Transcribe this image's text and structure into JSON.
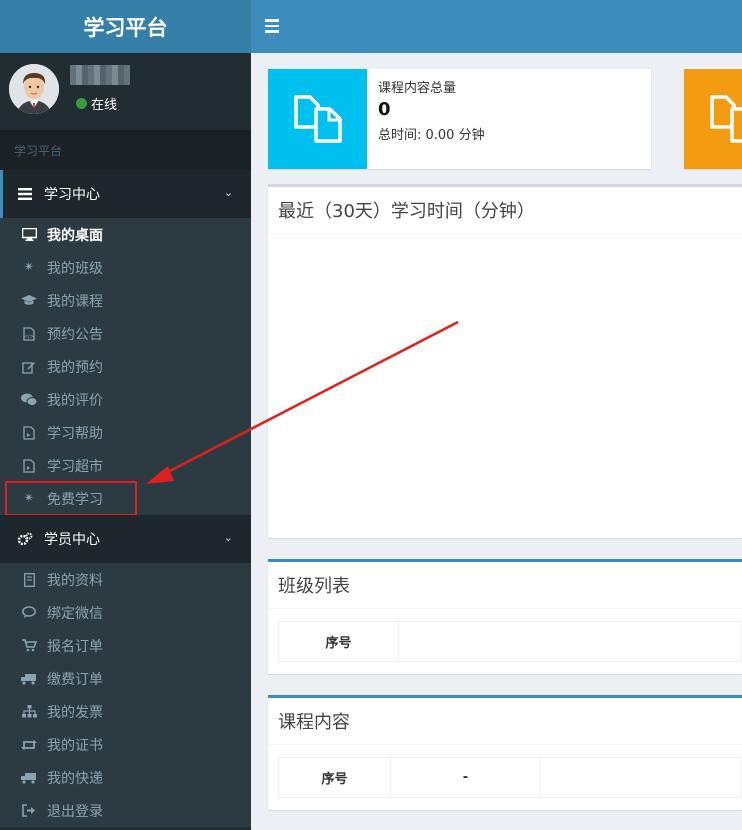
{
  "header": {
    "app_title": "学习平台"
  },
  "user": {
    "status": "在线"
  },
  "sidebar": {
    "section_label": "学习平台",
    "groups": [
      {
        "label": "学习中心",
        "items": [
          {
            "label": "我的桌面",
            "icon": "desktop-icon"
          },
          {
            "label": "我的班级",
            "icon": "asterisk-icon"
          },
          {
            "label": "我的课程",
            "icon": "graduation-cap-icon"
          },
          {
            "label": "预约公告",
            "icon": "file-code-icon"
          },
          {
            "label": "我的预约",
            "icon": "edit-icon"
          },
          {
            "label": "我的评价",
            "icon": "wechat-icon"
          },
          {
            "label": "学习帮助",
            "icon": "file-video-icon"
          },
          {
            "label": "学习超市",
            "icon": "file-video-icon"
          },
          {
            "label": "免费学习",
            "icon": "asterisk-icon"
          }
        ]
      },
      {
        "label": "学员中心",
        "items": [
          {
            "label": "我的资料",
            "icon": "book-icon"
          },
          {
            "label": "绑定微信",
            "icon": "comments-icon"
          },
          {
            "label": "报名订单",
            "icon": "cart-icon"
          },
          {
            "label": "缴费订单",
            "icon": "truck-icon"
          },
          {
            "label": "我的发票",
            "icon": "sitemap-icon"
          },
          {
            "label": "我的证书",
            "icon": "retweet-icon"
          },
          {
            "label": "我的快递",
            "icon": "truck-icon"
          },
          {
            "label": "退出登录",
            "icon": "sign-out-icon"
          }
        ]
      }
    ]
  },
  "stats": {
    "course_total_label": "课程内容总量",
    "course_total_value": "0",
    "total_time": "总时间: 0.00 分钟",
    "colors": {
      "card1": "#00c0ef",
      "card2": "#f39c12"
    }
  },
  "panels": {
    "study_time_title": "最近（30天）学习时间（分钟）",
    "class_list_title": "班级列表",
    "class_list_col1": "序号",
    "course_content_title": "课程内容",
    "course_content_col1": "序号",
    "course_content_col2": "-"
  }
}
